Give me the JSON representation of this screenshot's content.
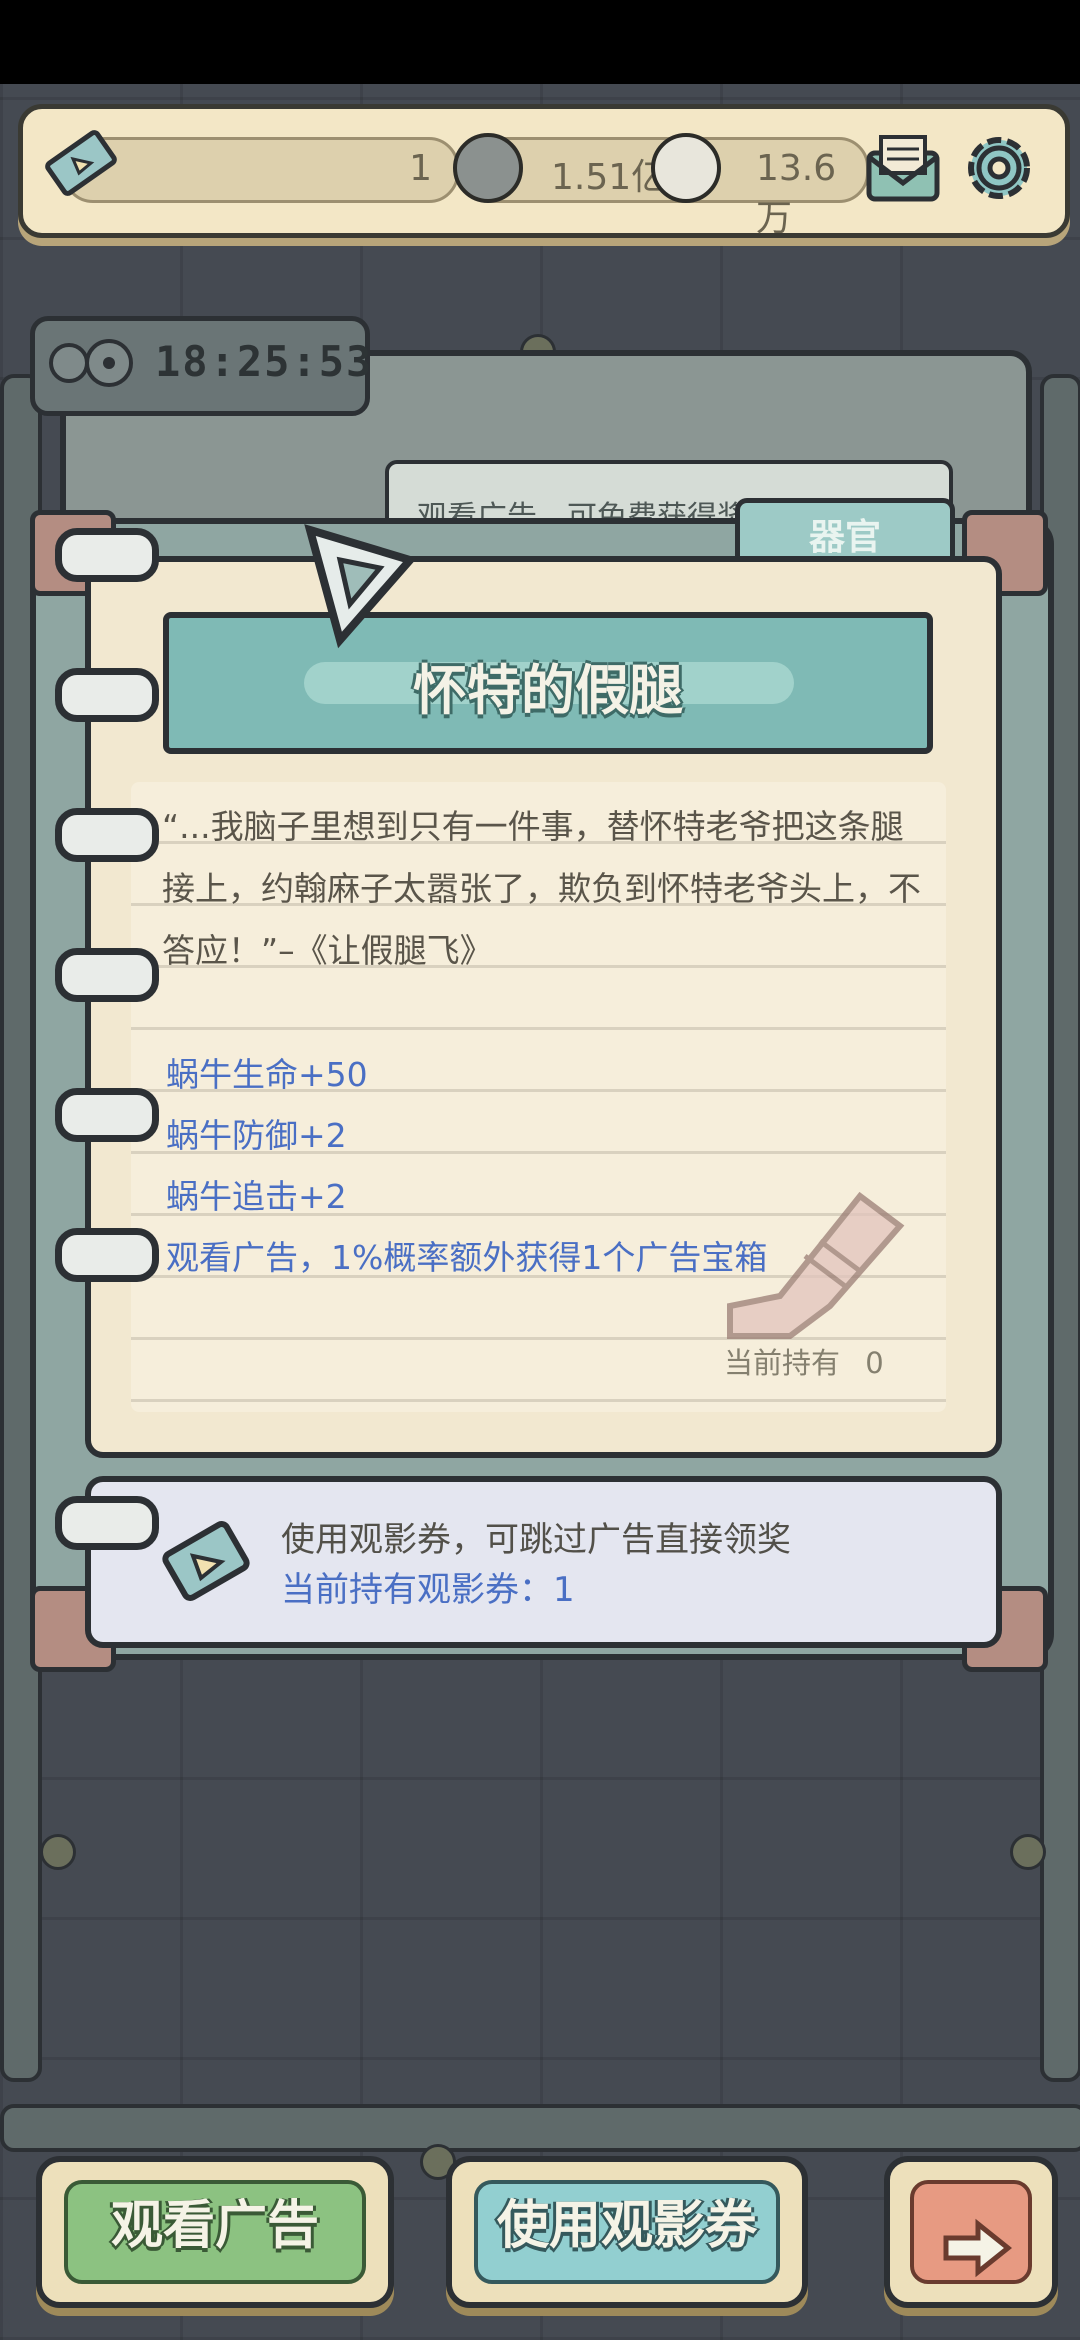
{
  "topbar": {
    "ticket_count": "1",
    "coins": "1.51亿",
    "gems": "13.6万"
  },
  "timer": "18:25:53",
  "hint": "观看广告，可免费获得奖",
  "tab": "器官",
  "card": {
    "title": "怀特的假腿",
    "quote": "“...我脑子里想到只有一件事，替怀特老爷把这条腿接上，约翰麻子太嚣张了，欺负到怀特老爷头上，不答应！”–《让假腿飞》",
    "stats": [
      "蜗牛生命+50",
      "蜗牛防御+2",
      "蜗牛追击+2",
      "观看广告，1%概率额外获得1个广告宝箱"
    ],
    "owned_label": "当前持有",
    "owned_count": "0"
  },
  "coupon": {
    "line1": "使用观影券，可跳过广告直接领奖",
    "line2": "当前持有观影券：1"
  },
  "buttons": {
    "watch_ad": "观看广告",
    "use_coupon": "使用观影券"
  },
  "colors": {
    "stat_blue": "#4a6fc4",
    "title_teal": "#7fbab5",
    "paper": "#f2e8d0"
  }
}
